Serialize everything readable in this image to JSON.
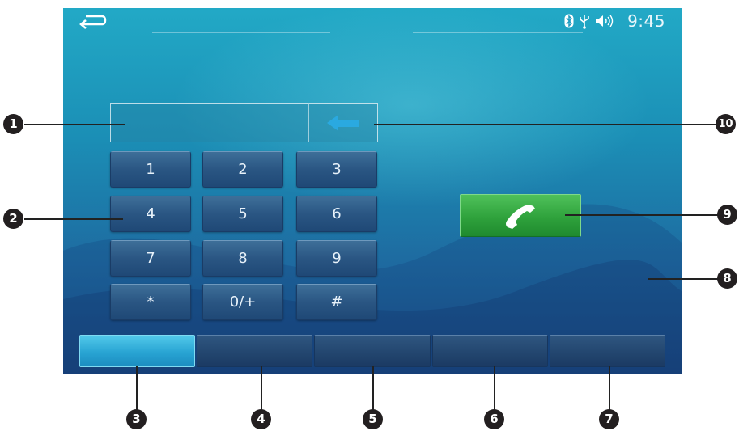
{
  "status_bar": {
    "time": "9:45",
    "icons": [
      "back-arrow-icon",
      "bluetooth-icon",
      "usb-icon",
      "volume-icon"
    ]
  },
  "dialer": {
    "input_value": "",
    "keys": [
      {
        "label": "1"
      },
      {
        "label": "2"
      },
      {
        "label": "3"
      },
      {
        "label": "4"
      },
      {
        "label": "5"
      },
      {
        "label": "6"
      },
      {
        "label": "7"
      },
      {
        "label": "8"
      },
      {
        "label": "9"
      },
      {
        "label": "*"
      },
      {
        "label": "0/+"
      },
      {
        "label": "#"
      }
    ],
    "backspace_icon": "backspace-arrow-icon",
    "call_icon": "phone-handset-icon"
  },
  "tabs": [
    {
      "label": "",
      "active": true
    },
    {
      "label": "",
      "active": false
    },
    {
      "label": "",
      "active": false
    },
    {
      "label": "",
      "active": false
    },
    {
      "label": "",
      "active": false
    }
  ],
  "callouts": [
    "1",
    "2",
    "3",
    "4",
    "5",
    "6",
    "7",
    "8",
    "9",
    "10"
  ],
  "colors": {
    "screen_top": "#22a9c6",
    "screen_bottom": "#1b4a82",
    "key": "#2a5683",
    "call_button": "#2fa23c",
    "active_tab": "#28a4d3",
    "backspace_arrow": "#2aa9e0",
    "callout": "#231f20"
  }
}
